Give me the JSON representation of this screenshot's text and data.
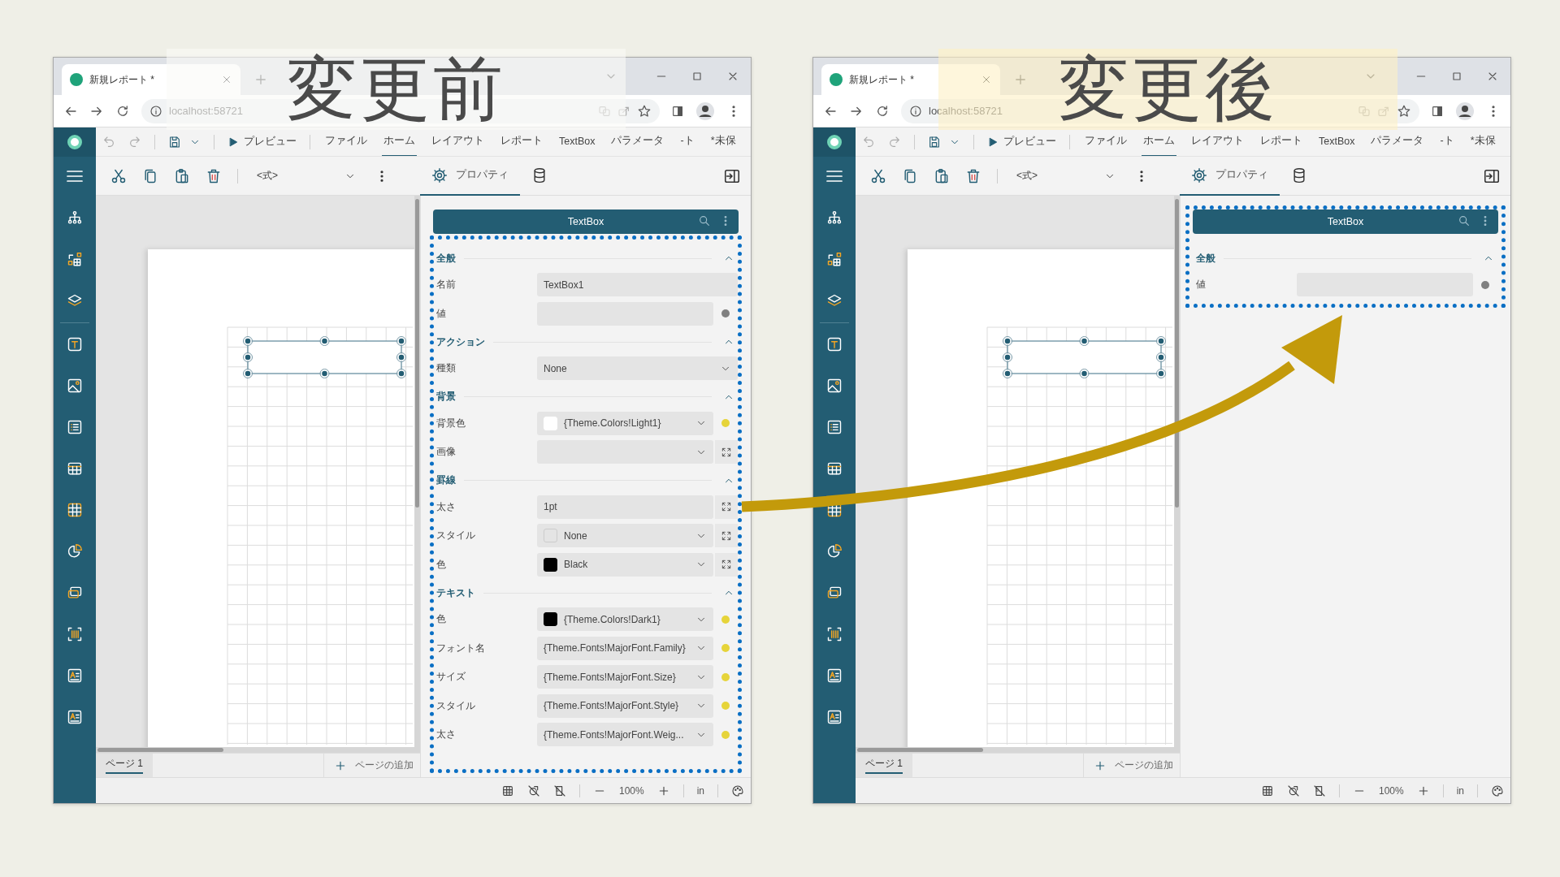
{
  "windows": [
    {
      "caption": {
        "text": "変更前",
        "kind": "before"
      },
      "browser": {
        "tab_title": "新規レポート *",
        "url": "localhost:58721"
      },
      "preview": "プレビュー",
      "menu": [
        {
          "label": "ファイル",
          "selected": false
        },
        {
          "label": "ホーム",
          "selected": true
        },
        {
          "label": "レイアウト",
          "selected": false
        },
        {
          "label": "レポート",
          "selected": false
        },
        {
          "label": "TextBox",
          "selected": false
        },
        {
          "label": "パラメータ",
          "selected": false
        },
        {
          "label": "-ト",
          "selected": false
        },
        {
          "label": "*未保",
          "selected": false
        }
      ],
      "expression": "<式>",
      "panel_tabs": [
        {
          "kind": "properties",
          "label": "プロパティ",
          "selected": true
        },
        {
          "kind": "data",
          "selected": false
        }
      ],
      "panel_title": "TextBox",
      "panel_highlighted": false,
      "sections_highlighted": true,
      "sections": [
        {
          "title": "全般",
          "expanded": true,
          "rows": [
            {
              "label": "名前",
              "kind": "text",
              "value": "TextBox1"
            },
            {
              "label": "値",
              "kind": "text",
              "dot": {
                "color": "#808080"
              }
            }
          ]
        },
        {
          "title": "アクション",
          "expanded": true,
          "rows": [
            {
              "label": "種類",
              "kind": "dropdown",
              "value": "None"
            }
          ]
        },
        {
          "title": "背景",
          "expanded": true,
          "rows": [
            {
              "label": "背景色",
              "kind": "dropdown",
              "swatch": {
                "color": "#ffffff"
              },
              "value": "{Theme.Colors!Light1}",
              "dot": {
                "color": "#e6d43a"
              }
            },
            {
              "label": "画像",
              "kind": "dropdown",
              "expand_button": true
            }
          ]
        },
        {
          "title": "罫線",
          "expanded": true,
          "rows": [
            {
              "label": "太さ",
              "kind": "text",
              "value": "1pt",
              "expand_button": true
            },
            {
              "label": "スタイル",
              "kind": "dropdown",
              "swatch": {
                "filled": false
              },
              "value": "None",
              "expand_button": true
            },
            {
              "label": "色",
              "kind": "dropdown",
              "swatch": {
                "color": "#000000"
              },
              "value": "Black",
              "expand_button": true
            }
          ]
        },
        {
          "title": "テキスト",
          "expanded": true,
          "rows": [
            {
              "label": "色",
              "kind": "dropdown",
              "swatch": {
                "color": "#000000"
              },
              "value": "{Theme.Colors!Dark1}",
              "dot": {
                "color": "#e6d43a"
              }
            },
            {
              "label": "フォント名",
              "kind": "dropdown",
              "value": "{Theme.Fonts!MajorFont.Family}",
              "dot": {
                "color": "#e6d43a"
              }
            },
            {
              "label": "サイズ",
              "kind": "dropdown",
              "value": "{Theme.Fonts!MajorFont.Size}",
              "dot": {
                "color": "#e6d43a"
              }
            },
            {
              "label": "スタイル",
              "kind": "dropdown",
              "value": "{Theme.Fonts!MajorFont.Style}",
              "dot": {
                "color": "#e6d43a"
              }
            },
            {
              "label": "太さ",
              "kind": "dropdown",
              "value": "{Theme.Fonts!MajorFont.Weig...",
              "dot": {
                "color": "#e6d43a"
              }
            }
          ]
        }
      ],
      "pages": [
        {
          "label": "ページ 1",
          "selected": true
        }
      ],
      "add_page": "ページの追加",
      "zoom": "100%",
      "unit": "in"
    },
    {
      "caption": {
        "text": "変更後",
        "kind": "after"
      },
      "browser": {
        "tab_title": "新規レポート *",
        "url": "localhost:58721"
      },
      "preview": "プレビュー",
      "menu": [
        {
          "label": "ファイル",
          "selected": false
        },
        {
          "label": "ホーム",
          "selected": true
        },
        {
          "label": "レイアウト",
          "selected": false
        },
        {
          "label": "レポート",
          "selected": false
        },
        {
          "label": "TextBox",
          "selected": false
        },
        {
          "label": "パラメータ",
          "selected": false
        },
        {
          "label": "-ト",
          "selected": false
        },
        {
          "label": "*未保",
          "selected": false
        }
      ],
      "expression": "<式>",
      "panel_tabs": [
        {
          "kind": "properties",
          "label": "プロパティ",
          "selected": true
        },
        {
          "kind": "data",
          "selected": false
        }
      ],
      "panel_title": "TextBox",
      "panel_highlighted": true,
      "sections_highlighted": false,
      "sections": [
        {
          "title": "全般",
          "expanded": true,
          "rows": [
            {
              "label": "値",
              "kind": "text",
              "dot": {
                "color": "#808080"
              }
            }
          ]
        }
      ],
      "pages": [
        {
          "label": "ページ 1",
          "selected": true
        }
      ],
      "add_page": "ページの追加",
      "zoom": "100%",
      "unit": "in"
    }
  ]
}
